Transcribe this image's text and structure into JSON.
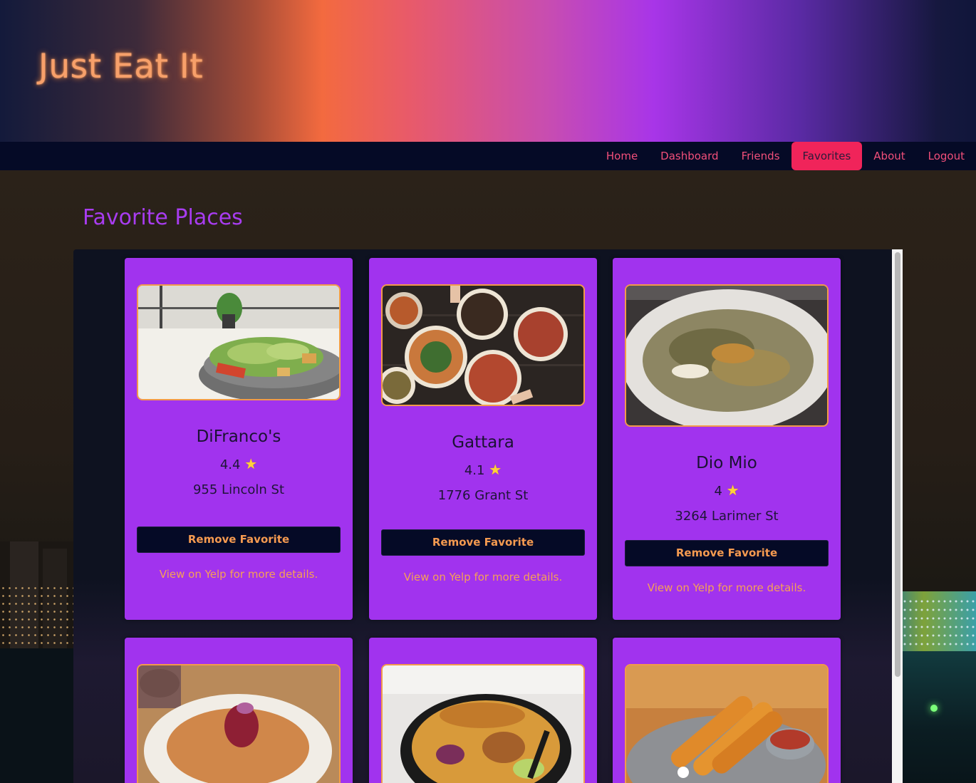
{
  "site": {
    "title": "Just Eat It"
  },
  "nav": {
    "items": [
      {
        "label": "Home",
        "active": false
      },
      {
        "label": "Dashboard",
        "active": false
      },
      {
        "label": "Friends",
        "active": false
      },
      {
        "label": "Favorites",
        "active": true
      },
      {
        "label": "About",
        "active": false
      },
      {
        "label": "Logout",
        "active": false
      }
    ]
  },
  "page": {
    "title": "Favorite Places"
  },
  "cards": [
    {
      "name": "DiFranco's",
      "rating": "4.4",
      "address": "955 Lincoln St",
      "button": "Remove Favorite",
      "link": "View on Yelp for more details.",
      "photo": "caesar-salad-bowl"
    },
    {
      "name": "Gattara",
      "rating": "4.1",
      "address": "1776 Grant St",
      "button": "Remove Favorite",
      "link": "View on Yelp for more details.",
      "photo": "pizzas-on-table"
    },
    {
      "name": "Dio Mio",
      "rating": "4",
      "address": "3264 Larimer St",
      "button": "Remove Favorite",
      "link": "View on Yelp for more details.",
      "photo": "pasta-plate"
    },
    {
      "photo": "curry-soup-bowl"
    },
    {
      "photo": "khao-soi-noodles"
    },
    {
      "photo": "spring-rolls"
    }
  ],
  "icons": {
    "rating": "star-icon"
  },
  "colors": {
    "accent": "#a133ee",
    "nav_active": "#f0245a",
    "link": "#f6a056",
    "button_bg": "#050a26"
  }
}
